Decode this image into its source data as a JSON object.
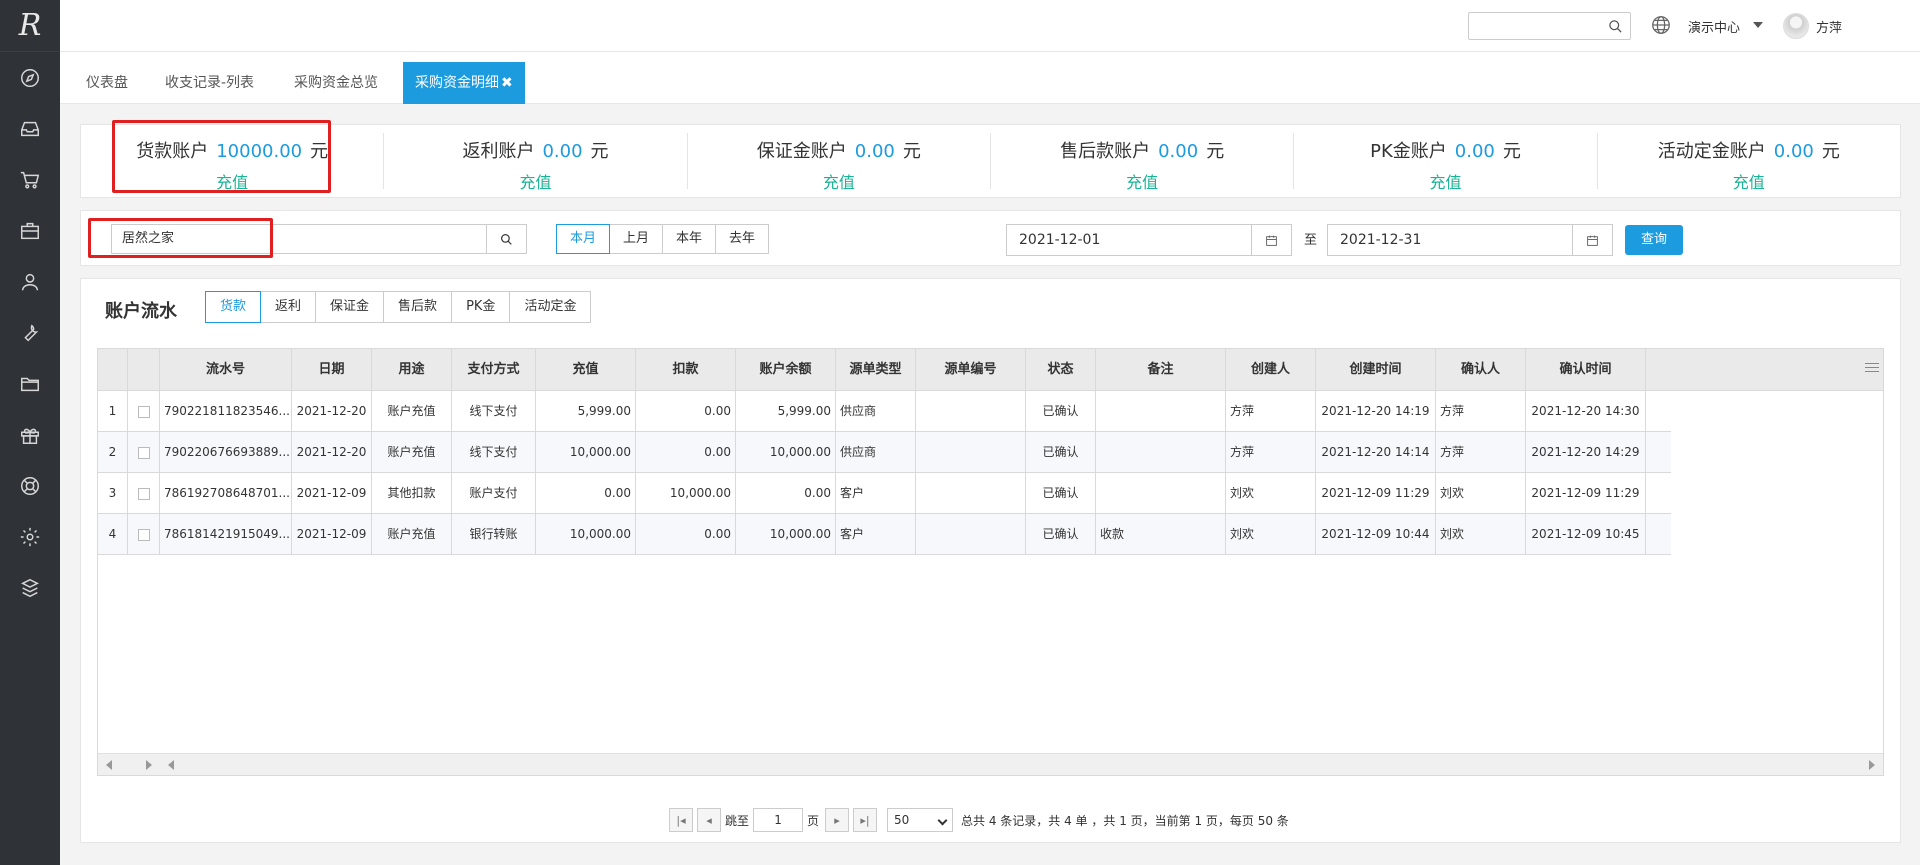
{
  "app": {
    "logo_text": "R"
  },
  "sidebar": {
    "icons": [
      "compass-icon",
      "inbox-icon",
      "cart-icon",
      "briefcase-icon",
      "user-icon",
      "wrench-icon",
      "folder-icon",
      "gift-icon",
      "support-icon",
      "gear-icon",
      "cubes-icon"
    ]
  },
  "topbar": {
    "search_value": "",
    "demo_center": "演示中心",
    "username": "方萍",
    "help": "?"
  },
  "tabs": [
    {
      "label": "仪表盘"
    },
    {
      "label": "收支记录-列表"
    },
    {
      "label": "采购资金总览"
    },
    {
      "label": "采购资金明细",
      "close": "✖"
    }
  ],
  "accounts": [
    {
      "name": "货款账户",
      "amount": "10000.00",
      "unit": "元",
      "action": "充值"
    },
    {
      "name": "返利账户",
      "amount": "0.00",
      "unit": "元",
      "action": "充值"
    },
    {
      "name": "保证金账户",
      "amount": "0.00",
      "unit": "元",
      "action": "充值"
    },
    {
      "name": "售后款账户",
      "amount": "0.00",
      "unit": "元",
      "action": "充值"
    },
    {
      "name": "PK金账户",
      "amount": "0.00",
      "unit": "元",
      "action": "充值"
    },
    {
      "name": "活动定金账户",
      "amount": "0.00",
      "unit": "元",
      "action": "充值"
    }
  ],
  "filter": {
    "keyword": "居然之家",
    "periods": [
      "本月",
      "上月",
      "本年",
      "去年"
    ],
    "start_date": "2021-12-01",
    "to": "至",
    "end_date": "2021-12-31",
    "query": "查询"
  },
  "ledger": {
    "title": "账户流水",
    "tabs": [
      "货款",
      "返利",
      "保证金",
      "售后款",
      "PK金",
      "活动定金"
    ],
    "columns": [
      "流水号",
      "日期",
      "用途",
      "支付方式",
      "充值",
      "扣款",
      "账户余额",
      "源单类型",
      "源单编号",
      "状态",
      "备注",
      "创建人",
      "创建时间",
      "确认人",
      "确认时间"
    ],
    "rows": [
      [
        "1",
        "790221811823546...",
        "2021-12-20",
        "账户充值",
        "线下支付",
        "5,999.00",
        "0.00",
        "5,999.00",
        "供应商",
        "",
        "已确认",
        "",
        "方萍",
        "2021-12-20 14:19",
        "方萍",
        "2021-12-20 14:30"
      ],
      [
        "2",
        "790220676693889...",
        "2021-12-20",
        "账户充值",
        "线下支付",
        "10,000.00",
        "0.00",
        "10,000.00",
        "供应商",
        "",
        "已确认",
        "",
        "方萍",
        "2021-12-20 14:14",
        "方萍",
        "2021-12-20 14:29"
      ],
      [
        "3",
        "786192708648701...",
        "2021-12-09",
        "其他扣款",
        "账户支付",
        "0.00",
        "10,000.00",
        "0.00",
        "客户",
        "",
        "已确认",
        "",
        "刘欢",
        "2021-12-09 11:29",
        "刘欢",
        "2021-12-09 11:29"
      ],
      [
        "4",
        "786181421915049...",
        "2021-12-09",
        "账户充值",
        "银行转账",
        "10,000.00",
        "0.00",
        "10,000.00",
        "客户",
        "",
        "已确认",
        "收款",
        "刘欢",
        "2021-12-09 10:44",
        "刘欢",
        "2021-12-09 10:45"
      ]
    ]
  },
  "pager": {
    "jump_to": "跳至",
    "page_value": "1",
    "page_unit": "页",
    "page_size": "50",
    "summary": "总共 4 条记录，共 4 单 ，共 1 页，当前第 1 页，每页 50 条"
  }
}
